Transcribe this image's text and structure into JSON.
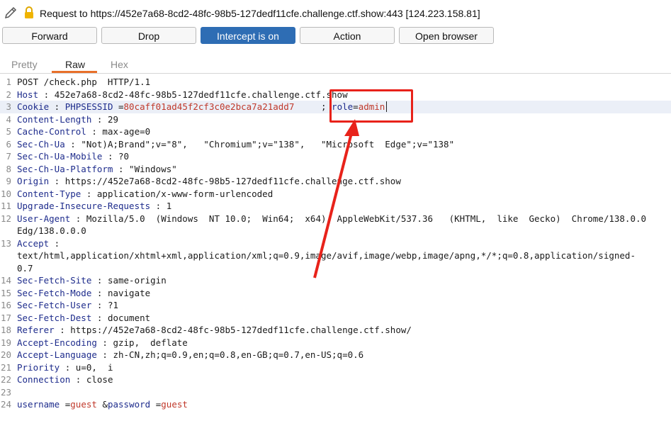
{
  "header": {
    "title": "Request to https://452e7a68-8cd2-48fc-98b5-127dedf11cfe.challenge.ctf.show:443  [124.223.158.81]"
  },
  "toolbar": {
    "forward": "Forward",
    "drop": "Drop",
    "intercept": "Intercept is on",
    "action": "Action",
    "open_browser": "Open browser"
  },
  "tabs": [
    "Pretty",
    "Raw",
    "Hex"
  ],
  "lines": [
    {
      "n": "1",
      "k": "",
      "v": "POST /check.php  HTTP/1.1"
    },
    {
      "n": "2",
      "k": "Host",
      "v": "452e7a68-8cd2-48fc-98b5-127dedf11cfe.challenge.ctf.show"
    },
    {
      "n": "3",
      "cookie": {
        "name1": "PHPSESSID",
        "val1": "80caff01ad45f2cf3c0e2bca7a21add7",
        "name2": "role",
        "val2": "admin"
      }
    },
    {
      "n": "4",
      "k": "Content-Length",
      "v": "29"
    },
    {
      "n": "5",
      "k": "Cache-Control",
      "v": "max-age=0"
    },
    {
      "n": "6",
      "k": "Sec-Ch-Ua",
      "v": "\"Not)A;Brand\";v=\"8\",   \"Chromium\";v=\"138\",   \"Microsoft  Edge\";v=\"138\""
    },
    {
      "n": "7",
      "k": "Sec-Ch-Ua-Mobile",
      "v": "?0"
    },
    {
      "n": "8",
      "k": "Sec-Ch-Ua-Platform",
      "v": "\"Windows\""
    },
    {
      "n": "9",
      "k": "Origin",
      "v": "https://452e7a68-8cd2-48fc-98b5-127dedf11cfe.challenge.ctf.show"
    },
    {
      "n": "10",
      "k": "Content-Type",
      "v": "application/x-www-form-urlencoded"
    },
    {
      "n": "11",
      "k": "Upgrade-Insecure-Requests",
      "v": "1"
    },
    {
      "n": "12",
      "k": "User-Agent",
      "v": "Mozilla/5.0  (Windows  NT 10.0;  Win64;  x64)  AppleWebKit/537.36   (KHTML,  like  Gecko)  Chrome/138.0.0"
    },
    {
      "n": "",
      "k": "",
      "v": "Edg/138.0.0.0"
    },
    {
      "n": "13",
      "k": "Accept",
      "v": ""
    },
    {
      "n": "",
      "k": "",
      "v": "text/html,application/xhtml+xml,application/xml;q=0.9,image/avif,image/webp,image/apng,*/*;q=0.8,application/signed-"
    },
    {
      "n": "",
      "k": "",
      "v": "0.7"
    },
    {
      "n": "14",
      "k": "Sec-Fetch-Site",
      "v": "same-origin"
    },
    {
      "n": "15",
      "k": "Sec-Fetch-Mode",
      "v": "navigate"
    },
    {
      "n": "16",
      "k": "Sec-Fetch-User",
      "v": "?1"
    },
    {
      "n": "17",
      "k": "Sec-Fetch-Dest",
      "v": "document"
    },
    {
      "n": "18",
      "k": "Referer",
      "v": "https://452e7a68-8cd2-48fc-98b5-127dedf11cfe.challenge.ctf.show/"
    },
    {
      "n": "19",
      "k": "Accept-Encoding",
      "v": "gzip,  deflate"
    },
    {
      "n": "20",
      "k": "Accept-Language",
      "v": "zh-CN,zh;q=0.9,en;q=0.8,en-GB;q=0.7,en-US;q=0.6"
    },
    {
      "n": "21",
      "k": "Priority",
      "v": "u=0,  i"
    },
    {
      "n": "22",
      "k": "Connection",
      "v": "close"
    },
    {
      "n": "23",
      "k": "",
      "v": ""
    },
    {
      "n": "24",
      "body": {
        "name1": "username",
        "val1": "guest",
        "name2": "password",
        "val2": "guest"
      }
    }
  ],
  "colors": {
    "accent": "#e8702a",
    "intercept_blue": "#2e6db4",
    "annotation_red": "#e8221a"
  }
}
